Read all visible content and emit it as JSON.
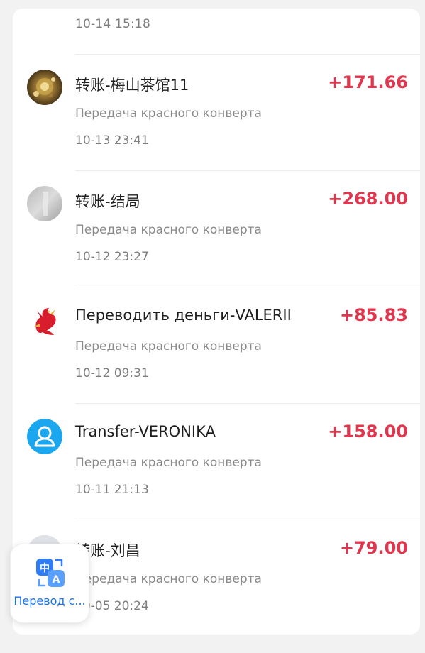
{
  "top_item": {
    "date": "10-14 15:18"
  },
  "transactions": [
    {
      "title": "转账-梅山茶馆11",
      "subtitle": "Передача красного конверта",
      "date": "10-13 23:41",
      "amount": "+171.66",
      "avatar_icon": "golden-ornament-avatar"
    },
    {
      "title": "转账-结局",
      "subtitle": "Передача красного конверта",
      "date": "10-12 23:27",
      "amount": "+268.00",
      "avatar_icon": "gray-photo-avatar"
    },
    {
      "title": "Переводить деньги-VALERII",
      "subtitle": "Передача красного конверта",
      "date": "10-12 09:31",
      "amount": "+85.83",
      "avatar_icon": "red-dragon-avatar"
    },
    {
      "title": "Transfer-VERONIKA",
      "subtitle": "Передача красного конверта",
      "date": "10-11 21:13",
      "amount": "+158.00",
      "avatar_icon": "default-user-avatar"
    },
    {
      "title": "转账-刘昌",
      "subtitle": "Передача красного конверта",
      "date": "10-05 20:24",
      "amount": "+79.00",
      "avatar_icon": "gray-photo-avatar"
    }
  ],
  "translate_widget": {
    "label": "Перевод с...",
    "icon": "translate-icon"
  },
  "colors": {
    "amount": "#e0364e",
    "link": "#1a73e8",
    "avatar_blue": "#1aa7f0"
  }
}
